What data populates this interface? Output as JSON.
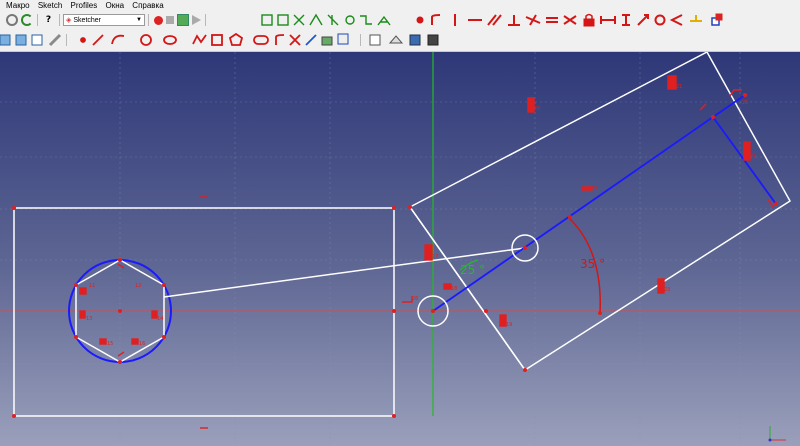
{
  "menu": {
    "items": [
      "Макро",
      "Sketch",
      "Profiles",
      "Окна",
      "Справка"
    ]
  },
  "workbench": {
    "label": "Sketcher"
  },
  "icons_row1": [
    "nav-icon",
    "refresh-icon",
    "whatsthis-icon",
    "record-macro-icon",
    "stop-macro-icon",
    "edit-macro-icon",
    "run-macro-icon",
    "select-constraints-icon",
    "conflict-icon",
    "symmetry-select-icon",
    "point-on-object-icon",
    "vertical-icon",
    "horizontal-icon",
    "parallel-icon",
    "perpendicular-icon",
    "tangent-icon",
    "equal-icon",
    "symmetric-icon",
    "lock-icon",
    "horizontal-distance-icon",
    "vertical-distance-icon",
    "distance-icon",
    "radius-icon",
    "angle-icon",
    "snell-icon",
    "internal-alignment-icon"
  ],
  "icons_row2": [
    "view-front-icon",
    "view-top-icon",
    "view-right-icon",
    "measure-icon",
    "point-icon",
    "line-icon",
    "arc-icon",
    "circle-icon",
    "conic-icon",
    "polyline-icon",
    "rectangle-icon",
    "polygon-icon",
    "slot-icon",
    "fillet-icon",
    "trim-icon",
    "extend-icon",
    "external-geometry-icon",
    "carbon-copy-icon",
    "construction-mode-icon",
    "mirror-icon",
    "clone-icon",
    "copy-icon"
  ],
  "colors": {
    "geometry": "#ffffff",
    "constraint": "#e02020",
    "construction": "#1a1aff",
    "axis_v": "#22bb22",
    "axis_h": "#d05050"
  },
  "sketch": {
    "angle_label_1": "25 °",
    "angle_label_2": "35 °",
    "small_labels": [
      "11",
      "12",
      "13",
      "14",
      "15",
      "16",
      "17",
      "18",
      "19",
      "20",
      "21",
      "22",
      "23",
      "24",
      "25",
      "26"
    ]
  }
}
